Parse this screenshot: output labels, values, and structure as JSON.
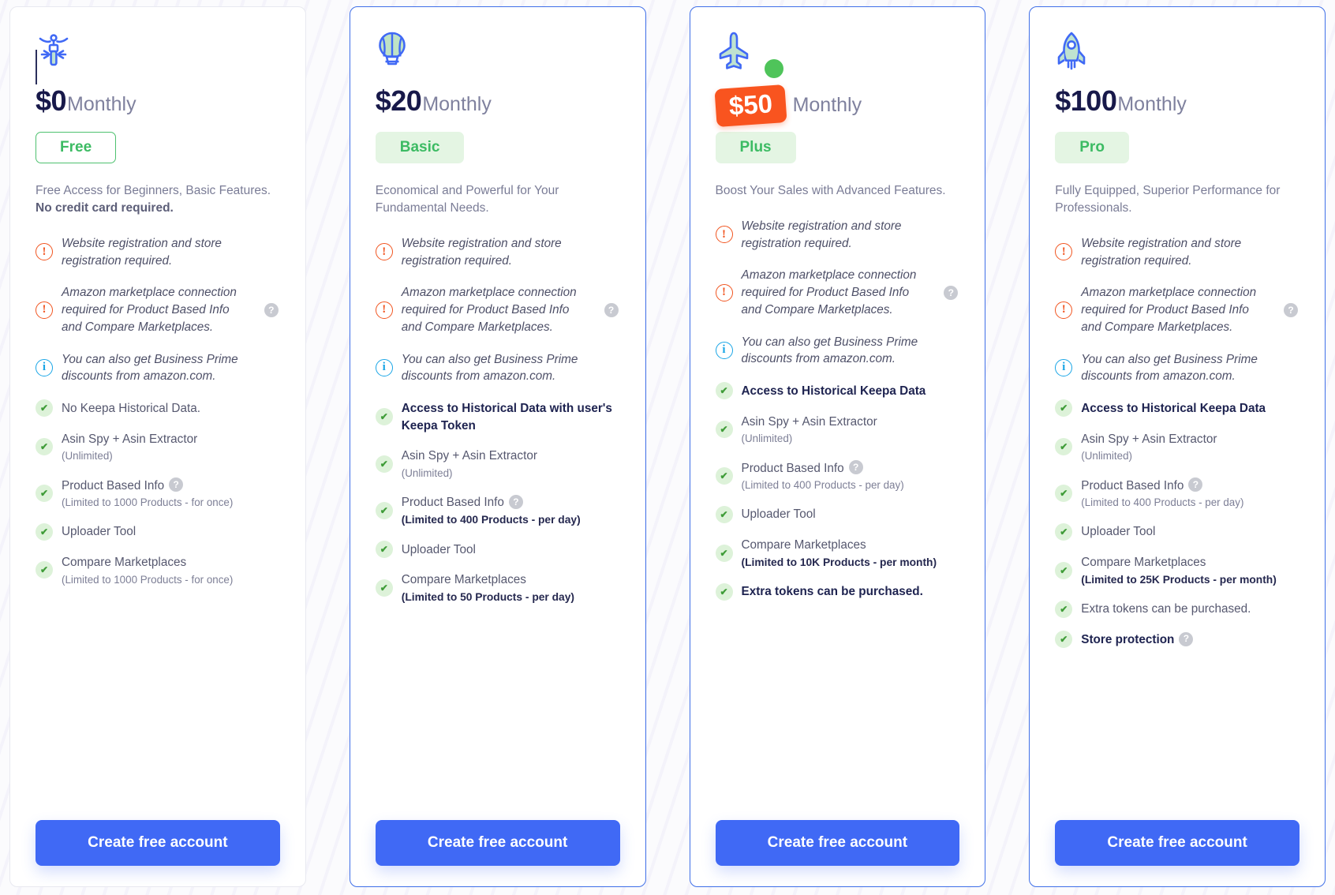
{
  "plans": [
    {
      "icon_name": "bicycle-icon",
      "price": "$0",
      "period": "Monthly",
      "badge": "Free",
      "badge_style": "outline",
      "tagline": "Free Access for Beginners, Basic Features.",
      "tagline_bold": "No credit card required.",
      "cta": "Create free account",
      "features": [
        {
          "type": "alert",
          "text": "Website registration and store registration required.",
          "note": true
        },
        {
          "type": "alert",
          "text": "Amazon marketplace connection required for Product Based Info and Compare Marketplaces.",
          "note": true,
          "help": true
        },
        {
          "type": "info",
          "text": "You can also get Business Prime discounts from amazon.com.",
          "note": true
        },
        {
          "type": "check",
          "text": "No Keepa Historical Data."
        },
        {
          "type": "check",
          "text": "Asin Spy + Asin Extractor",
          "sub": "(Unlimited)"
        },
        {
          "type": "check",
          "text": "Product Based Info",
          "help_inline": true,
          "sub": "(Limited to 1000 Products - for once)"
        },
        {
          "type": "check",
          "text": "Uploader Tool"
        },
        {
          "type": "check",
          "text": "Compare Marketplaces",
          "sub": "(Limited to 1000 Products - for once)"
        }
      ]
    },
    {
      "icon_name": "hot-air-balloon-icon",
      "price": "$20",
      "period": "Monthly",
      "badge": "Basic",
      "badge_style": "filled",
      "tagline": "Economical and Powerful for Your Fundamental Needs.",
      "tagline_bold": "",
      "cta": "Create free account",
      "highlight": true,
      "features": [
        {
          "type": "alert",
          "text": "Website registration and store registration required.",
          "note": true
        },
        {
          "type": "alert",
          "text": "Amazon marketplace connection required for Product Based Info and Compare Marketplaces.",
          "note": true,
          "help": true
        },
        {
          "type": "info",
          "text": "You can also get Business Prime discounts from amazon.com.",
          "note": true
        },
        {
          "type": "check",
          "text": "Access to Historical Data with user's Keepa Token",
          "bold": true
        },
        {
          "type": "check",
          "text": "Asin Spy + Asin Extractor",
          "sub": "(Unlimited)"
        },
        {
          "type": "check",
          "text": "Product Based Info",
          "help_inline": true,
          "sub_bold": "(Limited to 400 Products - per day)"
        },
        {
          "type": "check",
          "text": "Uploader Tool"
        },
        {
          "type": "check",
          "text": "Compare Marketplaces",
          "sub_bold": "(Limited to 50 Products - per day)"
        }
      ]
    },
    {
      "icon_name": "airplane-icon",
      "price": "$50",
      "period": "Monthly",
      "badge": "Plus",
      "badge_style": "filled",
      "price_tag": true,
      "green_dot": true,
      "tagline": "Boost Your Sales with Advanced Features.",
      "tagline_bold": "",
      "cta": "Create free account",
      "highlight": true,
      "features": [
        {
          "type": "alert",
          "text": "Website registration and store registration required.",
          "note": true
        },
        {
          "type": "alert",
          "text": "Amazon marketplace connection required for Product Based Info and Compare Marketplaces.",
          "note": true,
          "help": true
        },
        {
          "type": "info",
          "text": "You can also get Business Prime discounts from amazon.com.",
          "note": true
        },
        {
          "type": "check",
          "text": "Access to Historical Keepa Data",
          "bold": true
        },
        {
          "type": "check",
          "text": "Asin Spy + Asin Extractor",
          "sub": "(Unlimited)"
        },
        {
          "type": "check",
          "text": "Product Based Info",
          "help_inline": true,
          "sub": "(Limited to 400 Products - per day)"
        },
        {
          "type": "check",
          "text": "Uploader Tool"
        },
        {
          "type": "check",
          "text": "Compare Marketplaces",
          "sub_bold": "(Limited to 10K Products - per month)"
        },
        {
          "type": "check",
          "text": "Extra tokens can be purchased.",
          "bold": true
        }
      ]
    },
    {
      "icon_name": "rocket-icon",
      "price": "$100",
      "period": "Monthly",
      "badge": "Pro",
      "badge_style": "filled",
      "tagline": "Fully Equipped, Superior Performance for Professionals.",
      "tagline_bold": "",
      "cta": "Create free account",
      "highlight": true,
      "features": [
        {
          "type": "alert",
          "text": "Website registration and store registration required.",
          "note": true
        },
        {
          "type": "alert",
          "text": "Amazon marketplace connection required for Product Based Info and Compare Marketplaces.",
          "note": true,
          "help": true
        },
        {
          "type": "info",
          "text": "You can also get Business Prime discounts from amazon.com.",
          "note": true
        },
        {
          "type": "check",
          "text": "Access to Historical Keepa Data",
          "bold": true
        },
        {
          "type": "check",
          "text": "Asin Spy + Asin Extractor",
          "sub": "(Unlimited)"
        },
        {
          "type": "check",
          "text": "Product Based Info",
          "help_inline": true,
          "sub": "(Limited to 400 Products - per day)"
        },
        {
          "type": "check",
          "text": "Uploader Tool"
        },
        {
          "type": "check",
          "text": "Compare Marketplaces",
          "sub_bold": "(Limited to 25K Products - per month)"
        },
        {
          "type": "check",
          "text": "Extra tokens can be purchased."
        },
        {
          "type": "check",
          "text": "Store protection",
          "bold": true,
          "help_inline": true
        }
      ]
    }
  ],
  "glyphs": {
    "alert": "!",
    "info": "i",
    "check": "✔",
    "help": "?"
  },
  "colors": {
    "accent_blue": "#4069f5",
    "badge_green": "#3cbb63",
    "tag_orange": "#f9541f",
    "alert_orange": "#f1541f",
    "info_blue": "#18a5e6",
    "price_navy": "#18194a",
    "dot_green": "#4fc45a"
  }
}
